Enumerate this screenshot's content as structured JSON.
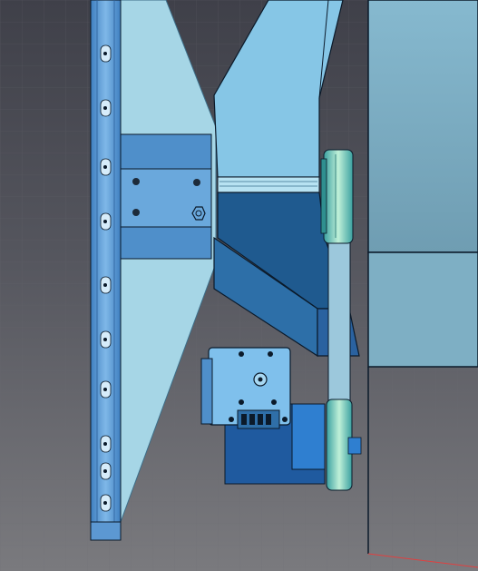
{
  "viewport": {
    "background_top": "#3f4049",
    "background_bottom": "#7a7a7e",
    "grid_color": "#6a6b72"
  },
  "palette": {
    "frame_blue": "#5f9fd8",
    "panel_light": "#9fd3e8",
    "panel_mid": "#7dbfe0",
    "block_blue": "#4f8fca",
    "duct_dark": "#1f5a8f",
    "duct_mid": "#2d6fa8",
    "housing_gray": "#7aa9c0",
    "pulley_green": "#9fe0c0",
    "motor_blue": "#2f7fd0",
    "outline": "#0b1a2a",
    "axis_red": "#e04040"
  },
  "parts": [
    {
      "name": "frame-rail",
      "icon": "vertical-rail"
    },
    {
      "name": "gusset-plate",
      "icon": "triangular-plate"
    },
    {
      "name": "mounting-block",
      "icon": "bracket-block"
    },
    {
      "name": "chute-panel",
      "icon": "angled-panel"
    },
    {
      "name": "discharge-duct",
      "icon": "duct"
    },
    {
      "name": "side-housing",
      "icon": "housing-panel"
    },
    {
      "name": "motor-assembly",
      "icon": "stepper-motor"
    },
    {
      "name": "drive-pulley-upper",
      "icon": "pulley"
    },
    {
      "name": "drive-pulley-lower",
      "icon": "pulley"
    },
    {
      "name": "drive-belt",
      "icon": "belt"
    },
    {
      "name": "axis-indicator",
      "icon": "axis-line"
    }
  ]
}
